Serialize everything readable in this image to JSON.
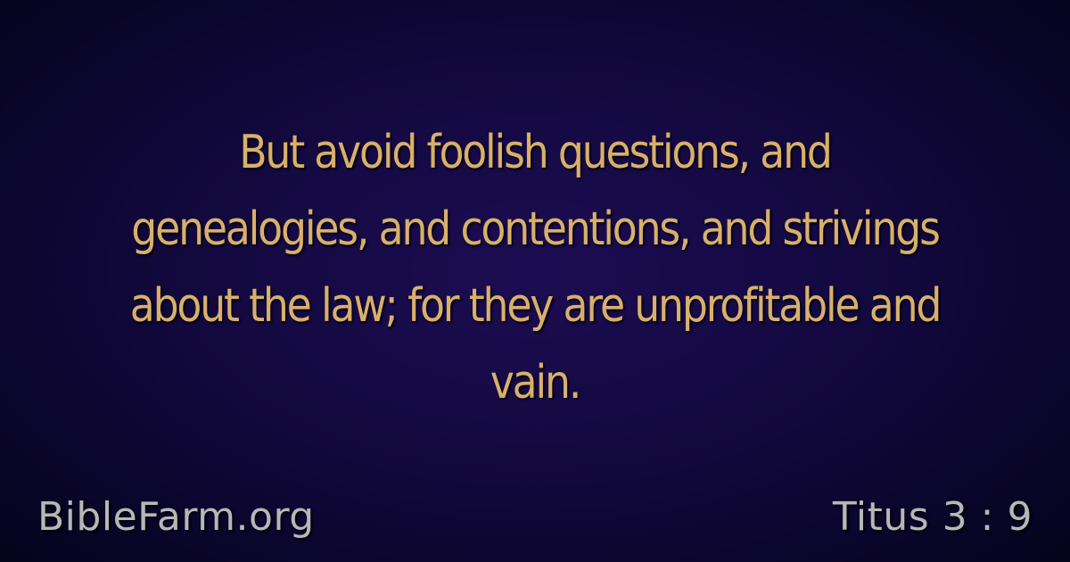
{
  "verse": {
    "lines": [
      "But avoid foolish questions, and",
      "genealogies, and contentions, and strivings",
      "about the law; for they are unprofitable and",
      "vain."
    ]
  },
  "footer": {
    "site": "BibleFarm.org",
    "reference": "Titus 3 : 9"
  },
  "colors": {
    "verse_text": "#d8b06a",
    "footer_text": "#b7b7b7",
    "background_center": "#1c0c52",
    "background_edge": "#05031b"
  }
}
